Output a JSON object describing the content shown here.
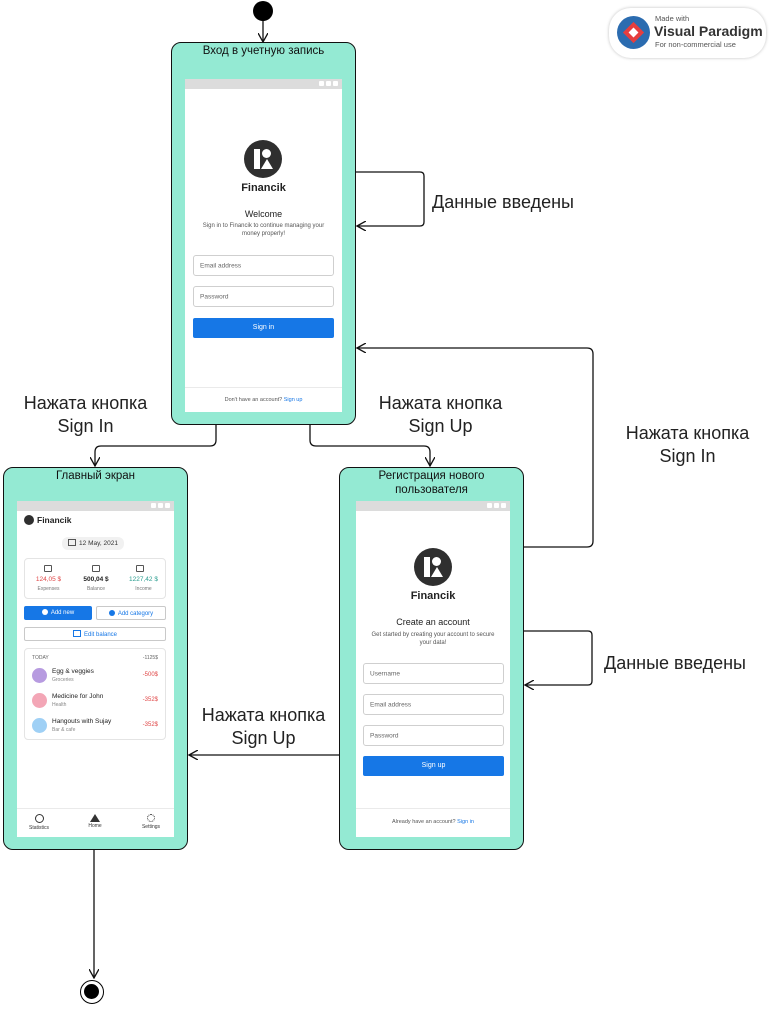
{
  "watermark": {
    "made_with": "Made with",
    "product": "Visual Paradigm",
    "note": "For non-commercial use"
  },
  "states": {
    "login": {
      "title": "Вход в учетную запись",
      "brand": "Financik",
      "heading": "Welcome",
      "subtitle": "Sign in to Financik to continue managing your money properly!",
      "email_placeholder": "Email address",
      "password_placeholder": "Password",
      "button": "Sign in",
      "footer_text": "Don't have an account?",
      "footer_link": "Sign up"
    },
    "main": {
      "title": "Главный экран",
      "brand": "Financik",
      "date": "12 May, 2021",
      "summary": [
        {
          "value": "124,05 $",
          "label": "Expenses",
          "color": "#e04848"
        },
        {
          "value": "500,04 $",
          "label": "Balance",
          "color": "#222222"
        },
        {
          "value": "1227,42 $",
          "label": "Income",
          "color": "#2a9d8f"
        }
      ],
      "add_new": "Add new",
      "add_category": "Add category",
      "edit_balance": "Edit balance",
      "today_label": "TODAY",
      "today_total": "-1125$",
      "transactions": [
        {
          "name": "Egg & veggies",
          "category": "Groceries",
          "amount": "-500$",
          "icon_color": "#b79be0"
        },
        {
          "name": "Medicine for John",
          "category": "Health",
          "amount": "-352$",
          "icon_color": "#f3a6b6"
        },
        {
          "name": "Hangouts with Sujay",
          "category": "Bar & cafe",
          "amount": "-352$",
          "icon_color": "#9fd0f5"
        }
      ],
      "nav": [
        "Statistics",
        "Home",
        "Settings"
      ]
    },
    "register": {
      "title": "Регистрация нового пользователя",
      "brand": "Financik",
      "heading": "Create an account",
      "subtitle": "Get started by creating your account to secure your data!",
      "username_placeholder": "Username",
      "email_placeholder": "Email address",
      "password_placeholder": "Password",
      "button": "Sign up",
      "footer_text": "Already have an account?",
      "footer_link": "Sign in"
    }
  },
  "transitions": {
    "login_self": "Данные введены",
    "login_to_main": "Нажата кнопка Sign In",
    "login_to_register": "Нажата кнопка Sign Up",
    "register_to_login": "Нажата кнопка Sign In",
    "register_self": "Данные введены",
    "register_to_main": "Нажата кнопка Sign Up"
  }
}
